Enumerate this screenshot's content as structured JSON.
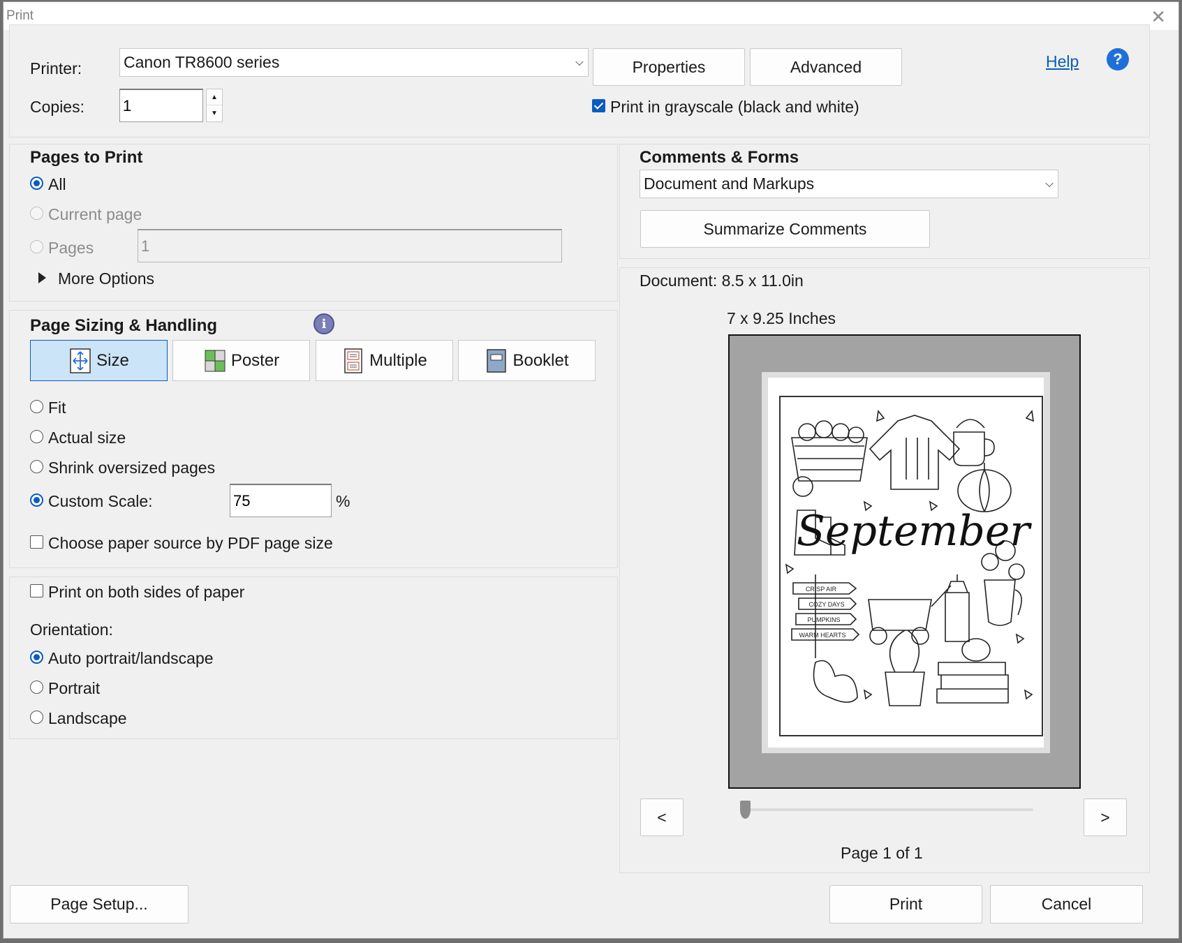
{
  "window": {
    "title": "Print"
  },
  "printer": {
    "label": "Printer:",
    "selected": "Canon TR8600 series",
    "properties_label": "Properties",
    "advanced_label": "Advanced",
    "help_label": "Help"
  },
  "copies": {
    "label": "Copies:",
    "value": "1"
  },
  "grayscale": {
    "label": "Print in grayscale (black and white)",
    "checked": true
  },
  "pages_to_print": {
    "heading": "Pages to Print",
    "all_label": "All",
    "current_label": "Current page",
    "pages_label": "Pages",
    "pages_value": "1",
    "more_options_label": "More Options",
    "selected": "All"
  },
  "page_sizing": {
    "heading": "Page Sizing & Handling",
    "tabs": [
      {
        "label": "Size",
        "icon": "size-icon",
        "active": true
      },
      {
        "label": "Poster",
        "icon": "poster-icon",
        "active": false
      },
      {
        "label": "Multiple",
        "icon": "multiple-icon",
        "active": false
      },
      {
        "label": "Booklet",
        "icon": "booklet-icon",
        "active": false
      }
    ],
    "fit_label": "Fit",
    "actual_label": "Actual size",
    "shrink_label": "Shrink oversized pages",
    "custom_label": "Custom Scale:",
    "custom_value": "75",
    "percent": "%",
    "paper_source_label": "Choose paper source by PDF page size",
    "selected": "Custom Scale"
  },
  "duplex": {
    "label": "Print on both sides of paper",
    "checked": false
  },
  "orientation": {
    "heading": "Orientation:",
    "auto_label": "Auto portrait/landscape",
    "portrait_label": "Portrait",
    "landscape_label": "Landscape",
    "selected": "Auto portrait/landscape"
  },
  "comments_forms": {
    "heading": "Comments & Forms",
    "selected": "Document and Markups",
    "summarize_label": "Summarize Comments"
  },
  "preview": {
    "document_size": "Document: 8.5 x 11.0in",
    "scaled_size": "7 x 9.25 Inches",
    "page_indicator": "Page 1 of 1",
    "prev_label": "<",
    "next_label": ">",
    "artwork_title": "September",
    "signs": [
      "CRISP AIR",
      "COZY DAYS",
      "PUMPKINS",
      "WARM HEARTS"
    ],
    "slider_position": 0
  },
  "footer": {
    "page_setup_label": "Page Setup...",
    "print_label": "Print",
    "cancel_label": "Cancel"
  },
  "colors": {
    "accent": "#0a5cbf",
    "help_link": "#0a5cbf",
    "help_icon": "#1e6fd9",
    "dialog_bg": "#f0f0f0"
  }
}
